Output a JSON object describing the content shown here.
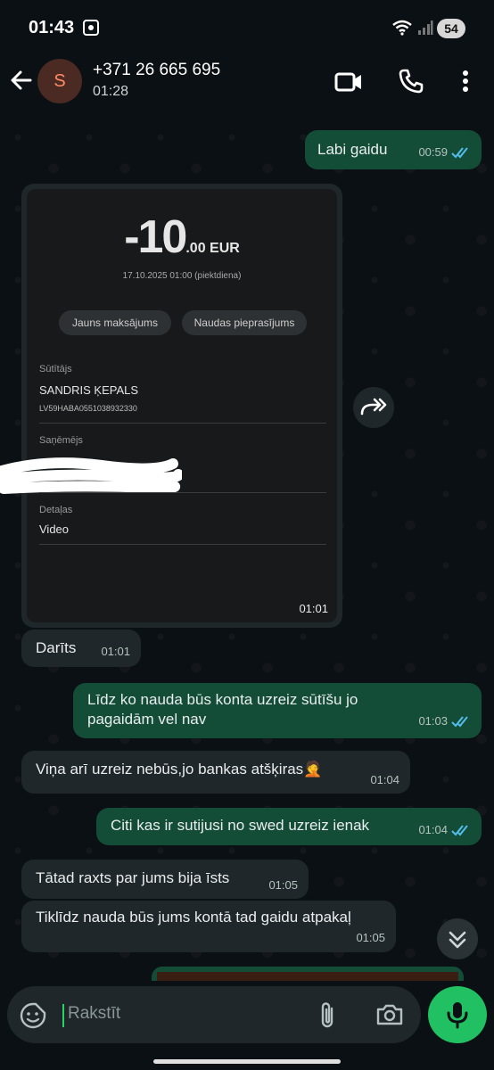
{
  "status_bar": {
    "time": "01:43",
    "battery": "54"
  },
  "header": {
    "avatar_letter": "S",
    "contact": "+371 26 665 695",
    "last_seen": "01:28"
  },
  "messages": [
    {
      "dir": "out",
      "text": "Labi gaidu",
      "time": "00:59",
      "read": true
    },
    {
      "dir": "in",
      "type": "image",
      "time": "01:01"
    },
    {
      "dir": "in",
      "text": "Darīts",
      "time": "01:01"
    },
    {
      "dir": "out",
      "text": "Līdz ko nauda būs konta uzreiz sūtīšu jo pagaidām vel nav",
      "time": "01:03",
      "read": true
    },
    {
      "dir": "in",
      "text": "Viņa arī uzreiz nebūs,jo bankas atšķiras🤦",
      "time": "01:04"
    },
    {
      "dir": "out",
      "text": "Citi kas ir sutijusi no swed uzreiz ienak",
      "time": "01:04",
      "read": true
    },
    {
      "dir": "in",
      "text": "Tātad raxts par jums bija īsts",
      "time": "01:05"
    },
    {
      "dir": "in",
      "text": "Tiklīdz nauda būs jums kontā tad gaidu atpakaļ",
      "time": "01:05"
    }
  ],
  "receipt": {
    "amount_main": "-10",
    "amount_cents": ".00 EUR",
    "date": "17.10.2025 01:00 (piektdiena)",
    "btn_new_payment": "Jauns maksājums",
    "btn_money_request": "Naudas pieprasījums",
    "sender_label": "Sūtītājs",
    "sender_name": "SANDRIS ĶEPALS",
    "sender_iban": "LV59HABA0551038932330",
    "recipient_label": "Saņēmējs",
    "details_label": "Detaļas",
    "details_value": "Video"
  },
  "input": {
    "placeholder": "Rakstīt"
  },
  "colors": {
    "outgoing": "#144d37",
    "incoming": "#1f272a",
    "accent": "#21c063",
    "read_ticks": "#53bdeb"
  },
  "icons": [
    "back-arrow-icon",
    "video-call-icon",
    "phone-icon",
    "more-vert-icon",
    "forward-icon",
    "scroll-down-icon",
    "sticker-icon",
    "attach-icon",
    "camera-icon",
    "mic-icon"
  ]
}
